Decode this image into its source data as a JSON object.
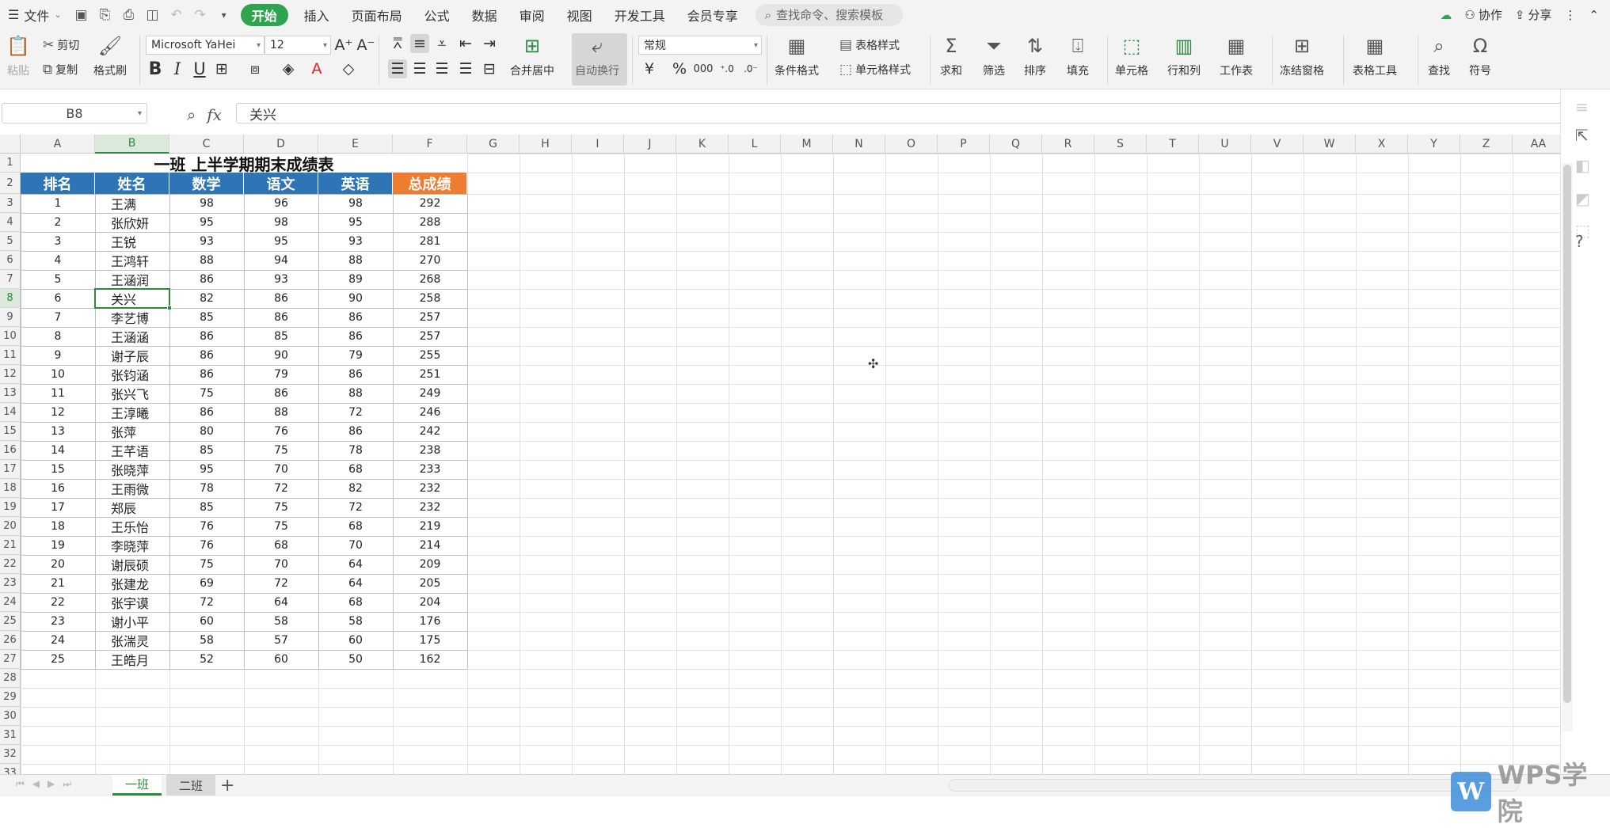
{
  "menubar": {
    "file_label": "文件",
    "tabs": [
      "开始",
      "插入",
      "页面布局",
      "公式",
      "数据",
      "审阅",
      "视图",
      "开发工具",
      "会员专享"
    ],
    "active_tab": "开始",
    "search_placeholder": "查找命令、搜索模板",
    "right": {
      "collab": "协作",
      "share": "分享"
    }
  },
  "ribbon": {
    "paste": "粘贴",
    "cut": "剪切",
    "copy": "复制",
    "format_painter": "格式刷",
    "font_name": "Microsoft YaHei",
    "font_size": "12",
    "merge_center": "合并居中",
    "wrap_text": "自动换行",
    "number_format": "常规",
    "conditional_format": "条件格式",
    "table_style": "表格样式",
    "cell_style": "单元格样式",
    "sum": "求和",
    "filter": "筛选",
    "sort": "排序",
    "fill": "填充",
    "cell": "单元格",
    "row_col": "行和列",
    "worksheet": "工作表",
    "freeze": "冻结窗格",
    "table_tools": "表格工具",
    "find": "查找",
    "symbol": "符号"
  },
  "formula_bar": {
    "cell_ref": "B8",
    "content": "关兴"
  },
  "columns": [
    "A",
    "B",
    "C",
    "D",
    "E",
    "F",
    "G",
    "H",
    "I",
    "J",
    "K",
    "L",
    "M",
    "N",
    "O",
    "P",
    "Q",
    "R",
    "S",
    "T",
    "U",
    "V",
    "W",
    "X",
    "Y",
    "Z",
    "AA"
  ],
  "selected_column": "B",
  "selected_row": 8,
  "sheet": {
    "title": "一班 上半学期期末成绩表",
    "headers": [
      "排名",
      "姓名",
      "数学",
      "语文",
      "英语",
      "总成绩"
    ],
    "rows": [
      [
        "1",
        "王满",
        "98",
        "96",
        "98",
        "292"
      ],
      [
        "2",
        "张欣妍",
        "95",
        "98",
        "95",
        "288"
      ],
      [
        "3",
        "王锐",
        "93",
        "95",
        "93",
        "281"
      ],
      [
        "4",
        "王鸿轩",
        "88",
        "94",
        "88",
        "270"
      ],
      [
        "5",
        "王涵润",
        "86",
        "93",
        "89",
        "268"
      ],
      [
        "6",
        "关兴",
        "82",
        "86",
        "90",
        "258"
      ],
      [
        "7",
        "李艺博",
        "85",
        "86",
        "86",
        "257"
      ],
      [
        "8",
        "王涵涵",
        "86",
        "85",
        "86",
        "257"
      ],
      [
        "9",
        "谢子辰",
        "86",
        "90",
        "79",
        "255"
      ],
      [
        "10",
        "张钧涵",
        "86",
        "79",
        "86",
        "251"
      ],
      [
        "11",
        "张兴飞",
        "75",
        "86",
        "88",
        "249"
      ],
      [
        "12",
        "王淳曦",
        "86",
        "88",
        "72",
        "246"
      ],
      [
        "13",
        "张萍",
        "80",
        "76",
        "86",
        "242"
      ],
      [
        "14",
        "王芊语",
        "85",
        "75",
        "78",
        "238"
      ],
      [
        "15",
        "张晓萍",
        "95",
        "70",
        "68",
        "233"
      ],
      [
        "16",
        "王雨微",
        "78",
        "72",
        "82",
        "232"
      ],
      [
        "17",
        "郑辰",
        "85",
        "75",
        "72",
        "232"
      ],
      [
        "18",
        "王乐怡",
        "76",
        "75",
        "68",
        "219"
      ],
      [
        "19",
        "李晓萍",
        "76",
        "68",
        "70",
        "214"
      ],
      [
        "20",
        "谢辰硕",
        "75",
        "70",
        "64",
        "209"
      ],
      [
        "21",
        "张建龙",
        "69",
        "72",
        "64",
        "205"
      ],
      [
        "22",
        "张宇谟",
        "72",
        "64",
        "68",
        "204"
      ],
      [
        "23",
        "谢小平",
        "60",
        "58",
        "58",
        "176"
      ],
      [
        "24",
        "张湍灵",
        "58",
        "57",
        "60",
        "175"
      ],
      [
        "25",
        "王皓月",
        "52",
        "60",
        "50",
        "162"
      ]
    ]
  },
  "sheet_tabs": [
    "一班",
    "二班"
  ],
  "active_sheet": "一班",
  "watermark": "WPS学院",
  "colors": {
    "header_blue": "#2e75b6",
    "header_orange": "#ed7d31",
    "accent_green": "#2fa44f"
  }
}
